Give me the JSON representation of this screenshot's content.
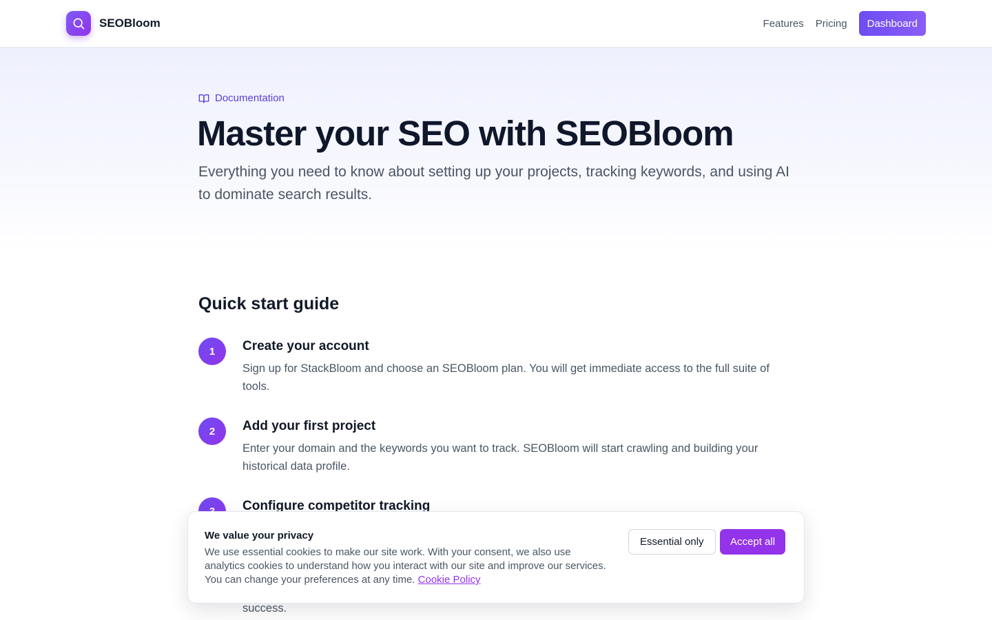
{
  "header": {
    "brand": "SEOBloom",
    "nav": [
      {
        "label": "Features"
      },
      {
        "label": "Pricing"
      }
    ],
    "cta_label": "Dashboard"
  },
  "hero": {
    "eyebrow": "Documentation",
    "title": "Master your SEO with SEOBloom",
    "subtitle": "Everything you need to know about setting up your projects, tracking keywords, and using AI to dominate search results."
  },
  "quickstart": {
    "title": "Quick start guide",
    "steps": [
      {
        "number": "1",
        "title": "Create your account",
        "desc": "Sign up for StackBloom and choose an SEOBloom plan. You will get immediate access to the full suite of tools."
      },
      {
        "number": "2",
        "title": "Add your first project",
        "desc": "Enter your domain and the keywords you want to track. SEOBloom will start crawling and building your historical data profile."
      },
      {
        "number": "3",
        "title": "Configure competitor tracking",
        "desc": ""
      }
    ],
    "trailing_text": "success."
  },
  "cookie": {
    "title": "We value your privacy",
    "text": "We use essential cookies to make our site work. With your consent, we also use analytics cookies to understand how you interact with our site and improve our services. You can change your preferences at any time.",
    "link_label": "Cookie Policy",
    "essential_label": "Essential only",
    "accept_label": "Accept all"
  },
  "colors": {
    "brand": "#7c3aed",
    "accent": "#9333ea",
    "eyebrow": "#5b3fd9"
  }
}
